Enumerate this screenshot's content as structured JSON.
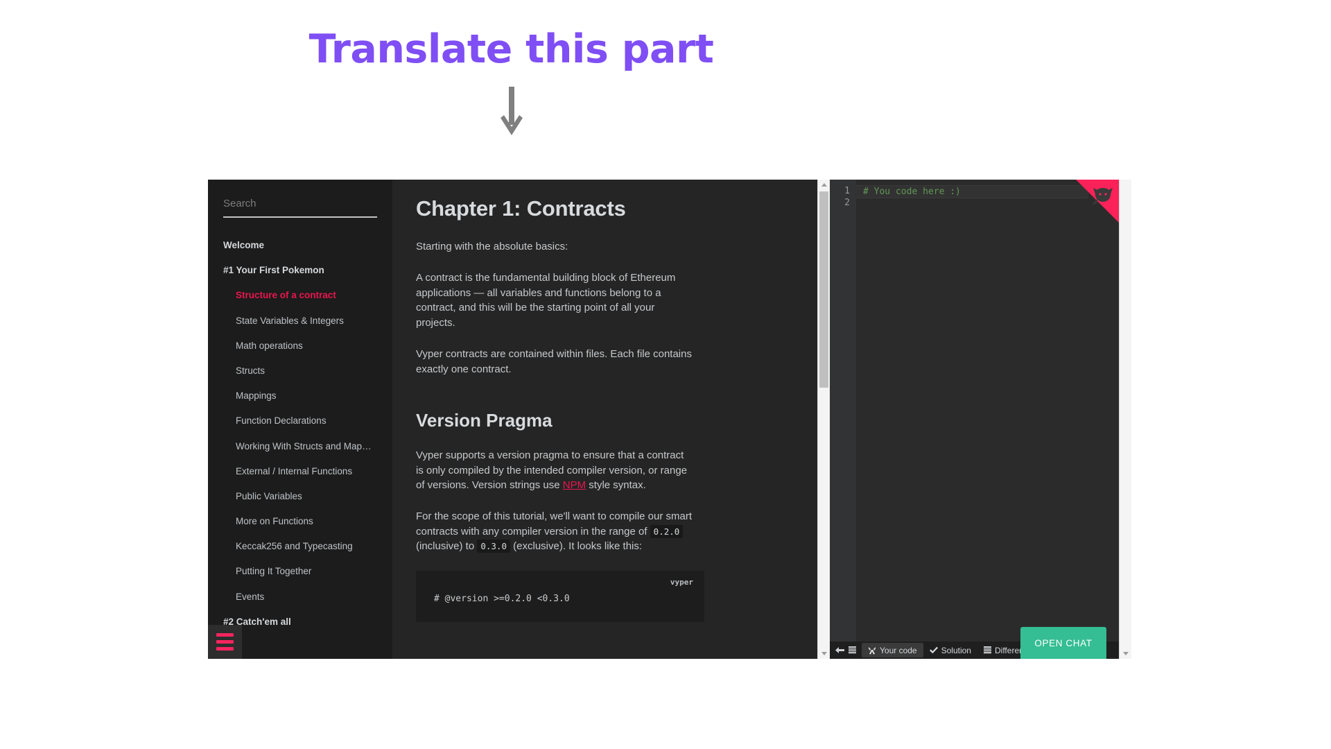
{
  "annotation": {
    "title": "Translate this part",
    "arrow_icon": "down-arrow-icon",
    "title_color": "#7f4ef4",
    "arrow_color": "#808080"
  },
  "sidebar": {
    "search": {
      "placeholder": "Search",
      "value": ""
    },
    "items": [
      {
        "label": "Welcome",
        "type": "chapter",
        "active": false
      },
      {
        "label": "#1 Your First Pokemon",
        "type": "chapter",
        "active": false
      },
      {
        "label": "Structure of a contract",
        "type": "lesson",
        "active": true
      },
      {
        "label": "State Variables & Integers",
        "type": "lesson",
        "active": false
      },
      {
        "label": "Math operations",
        "type": "lesson",
        "active": false
      },
      {
        "label": "Structs",
        "type": "lesson",
        "active": false
      },
      {
        "label": "Mappings",
        "type": "lesson",
        "active": false
      },
      {
        "label": "Function Declarations",
        "type": "lesson",
        "active": false
      },
      {
        "label": "Working With Structs and Map…",
        "type": "lesson",
        "active": false
      },
      {
        "label": "External / Internal Functions",
        "type": "lesson",
        "active": false
      },
      {
        "label": "Public Variables",
        "type": "lesson",
        "active": false
      },
      {
        "label": "More on Functions",
        "type": "lesson",
        "active": false
      },
      {
        "label": "Keccak256 and Typecasting",
        "type": "lesson",
        "active": false
      },
      {
        "label": "Putting It Together",
        "type": "lesson",
        "active": false
      },
      {
        "label": "Events",
        "type": "lesson",
        "active": false
      },
      {
        "label": "#2 Catch'em all",
        "type": "chapter",
        "active": false
      }
    ],
    "menu_button": {
      "icon": "hamburger-menu-icon",
      "color": "#f6245e"
    },
    "active_color": "#e8164f",
    "background": "#1c1c1c"
  },
  "content": {
    "heading": "Chapter 1: Contracts",
    "paragraph_1": "Starting with the absolute basics:",
    "paragraph_2": "A contract is the fundamental building block of Ethereum applications — all variables and functions belong to a contract, and this will be the starting point of all your projects.",
    "paragraph_3": "Vyper contracts are contained within files. Each file contains exactly one contract.",
    "subheading": "Version Pragma",
    "paragraph_4_before_link": "Vyper supports a version pragma to ensure that a contract is only compiled by the intended compiler version, or range of versions. Version strings use ",
    "link_label": "NPM",
    "paragraph_4_after_link": " style syntax.",
    "paragraph_5_a": "For the scope of this tutorial, we'll want to compile our smart contracts with any compiler version in the range of ",
    "chip_1": "0.2.0",
    "paragraph_5_b": " (inclusive) to ",
    "chip_2": "0.3.0",
    "paragraph_5_c": " (exclusive). It looks like this:",
    "code_language": "vyper",
    "code_text": "# @version >=0.2.0 <0.3.0"
  },
  "editor": {
    "gutter_lines": [
      "1",
      "2"
    ],
    "code_line": "# You code here :)",
    "code_color": "#629755",
    "ribbon": {
      "icon": "github-octocat-icon",
      "color": "#fb2259"
    },
    "tabs": {
      "nav_back_icon": "arrow-left-icon",
      "nav_list_icon": "list-icon",
      "items": [
        {
          "label": "Your code",
          "icon": "tools-icon",
          "active": true
        },
        {
          "label": "Solution",
          "icon": "check-icon",
          "active": false
        },
        {
          "label": "Difference",
          "icon": "list-icon",
          "active": false
        }
      ]
    }
  },
  "chat": {
    "open_label": "OPEN CHAT",
    "color": "#35bd93"
  },
  "scrollbars": {
    "content": {
      "thumb_top_pct": 3,
      "thumb_height_pct": 41
    },
    "editor": {
      "thumb_top_pct": 0,
      "thumb_height_pct": 0
    }
  }
}
